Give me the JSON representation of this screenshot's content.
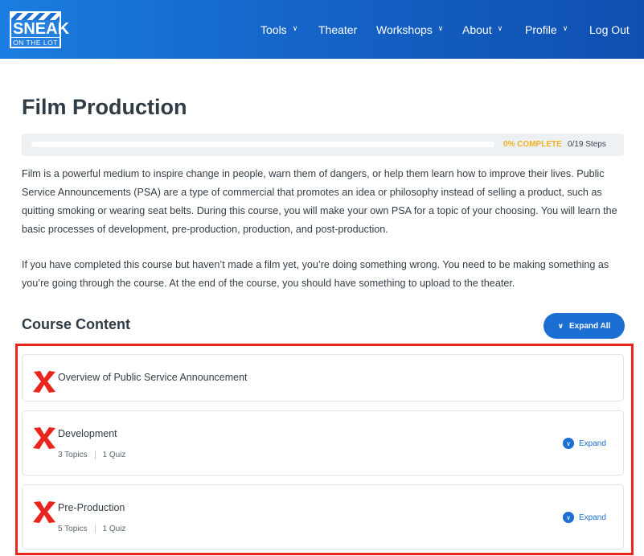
{
  "header": {
    "logo_main": "SNEAK",
    "logo_sub": "ON THE LOT",
    "nav": [
      {
        "label": "Tools",
        "dropdown": true
      },
      {
        "label": "Theater",
        "dropdown": false
      },
      {
        "label": "Workshops",
        "dropdown": true
      },
      {
        "label": "About",
        "dropdown": true
      },
      {
        "label": "Profile",
        "dropdown": true
      },
      {
        "label": "Log Out",
        "dropdown": false
      }
    ]
  },
  "course": {
    "title": "Film Production",
    "progress": {
      "percent": 0,
      "percent_label": "0% COMPLETE",
      "steps_label": "0/19 Steps"
    },
    "description": [
      "Film is a powerful medium to inspire change in people, warn them of dangers, or help them learn how to improve their lives. Public Service Announcements (PSA) are a type of commercial that promotes an idea or philosophy instead of selling a product, such as quitting smoking or wearing seat belts. During this course, you will make your own PSA for a topic of your choosing. You will learn the basic processes of development, pre-production, production, and post-production.",
      "If you have completed this course but haven’t made a film yet, you’re doing something wrong.  You need to be making something as you’re going through the course.  At the end of the course, you should have something to upload to the theater."
    ]
  },
  "content": {
    "title": "Course Content",
    "expand_all_label": "Expand All",
    "lessons": [
      {
        "name": "Overview of Public Service Announcement",
        "topics": "",
        "quiz": "",
        "expand_label": ""
      },
      {
        "name": "Development",
        "topics": "3 Topics",
        "quiz": "1 Quiz",
        "expand_label": "Expand"
      },
      {
        "name": "Pre-Production",
        "topics": "5 Topics",
        "quiz": "1 Quiz",
        "expand_label": "Expand"
      }
    ]
  },
  "colors": {
    "header_blue": "#1565c8",
    "accent_blue": "#1b6fd2",
    "progress_amber": "#f0b323",
    "incomplete_red": "#e8261d",
    "highlight_red": "#e8261d"
  },
  "icons": {
    "nav_dropdown": "chevron-down-icon",
    "lesson_status": "x-mark-icon",
    "expand": "chevron-down-circle-icon"
  }
}
